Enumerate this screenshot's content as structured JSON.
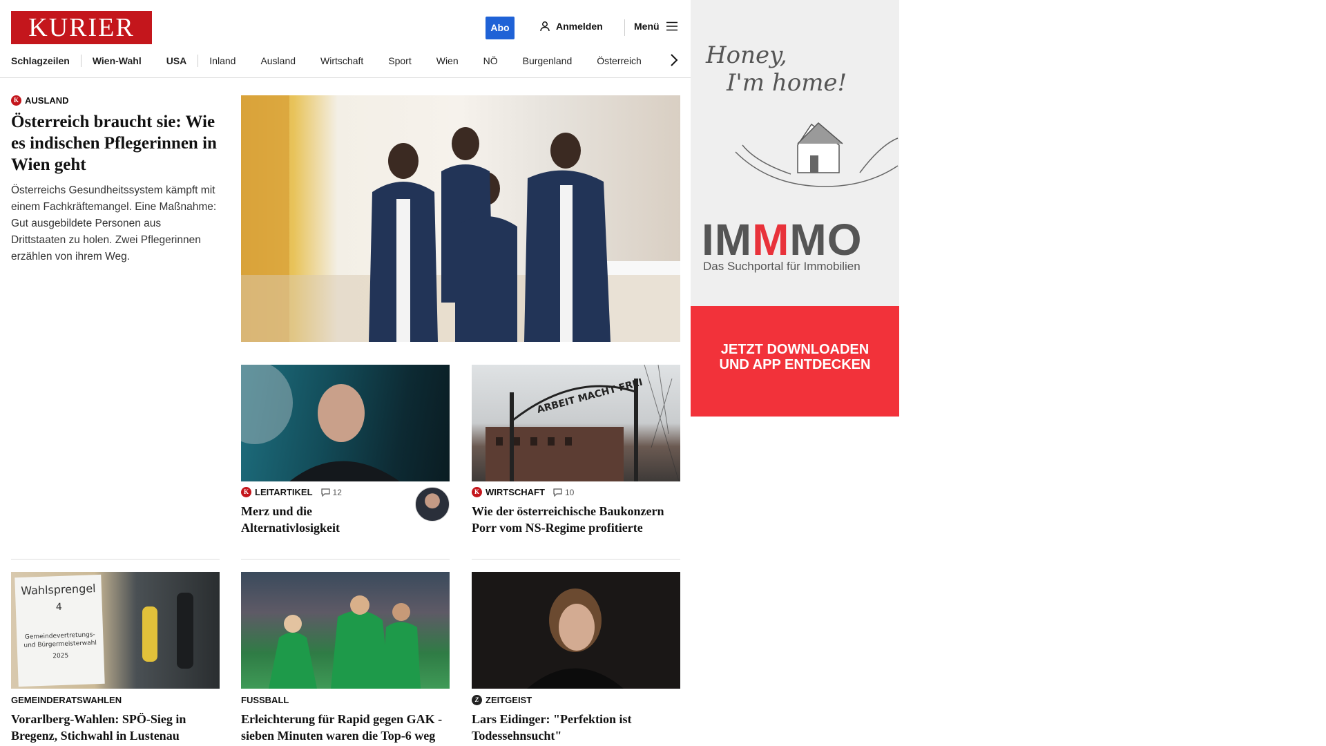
{
  "header": {
    "logo": "KURIER",
    "abo_label": "Abo",
    "login_label": "Anmelden",
    "menu_label": "Menü",
    "nav": [
      "Schlagzeilen",
      "Wien-Wahl",
      "USA",
      "Inland",
      "Ausland",
      "Wirtschaft",
      "Sport",
      "Wien",
      "NÖ",
      "Burgenland",
      "Österreich"
    ]
  },
  "lead": {
    "category": "AUSLAND",
    "title": "Österreich braucht sie: Wie es indischen Pflegerinnen in Wien geht",
    "teaser": "Österreichs Gesundheitssystem kämpft mit einem Fachkräftemangel. Eine Maßnahme: Gut ausgebildete Personen aus Drittstaaten zu holen. Zwei Pflegerinnen erzählen von ihrem Weg."
  },
  "cards": [
    {
      "category": "LEITARTIKEL",
      "comments": "12",
      "title": "Merz und die Alternativlosigkeit"
    },
    {
      "category": "WIRTSCHAFT",
      "comments": "10",
      "title": "Wie der österreichische Baukonzern Porr vom NS-Regime profitierte"
    },
    {
      "category": "GEMEINDERATSWAHLEN",
      "title": "Vorarlberg-Wahlen: SPÖ-Sieg in Bregenz, Stichwahl in Lustenau"
    },
    {
      "category": "FUSSBALL",
      "title": "Erleichterung für Rapid gegen GAK - sieben Minuten waren die Top-6 weg"
    },
    {
      "category": "ZEITGEIST",
      "title": "Lars Eidinger: \"Perfektion ist Todessehnsucht\""
    }
  ],
  "images": {
    "sign_text_1": "Wahlsprengel",
    "sign_text_2": "4",
    "sign_text_3": "Gemeindevertretungs- und Bürgermeisterwahl",
    "sign_text_4": "2025",
    "gate_text": "ARBEIT MACHT FREI"
  },
  "ad": {
    "script_line_1": "Honey,",
    "script_line_2": "I'm home!",
    "brand_a": "IM",
    "brand_b": "M",
    "brand_c": "MO",
    "subtitle": "Das Suchportal für Immobilien",
    "cta_line_1": "JETZT DOWNLOADEN",
    "cta_line_2": "UND APP ENTDECKEN"
  },
  "colors": {
    "brand_red": "#c4161c",
    "abo_blue": "#1f62d6",
    "ad_red": "#f2323a"
  }
}
